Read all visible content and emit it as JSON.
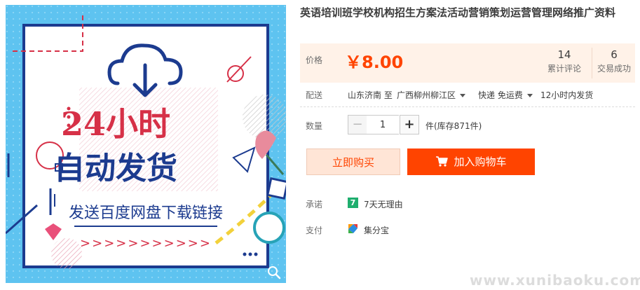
{
  "product": {
    "title": "英语培训班学校机构招生方案法活动营销策划运营管理网络推广资料",
    "image": {
      "headline_1": "24小时",
      "headline_2": "自动发货",
      "subline": "发送百度网盘下载链接",
      "arrows": ">>>>>>>>>>>"
    }
  },
  "price": {
    "label": "价格",
    "value": "￥8.00",
    "reviews_count": "14",
    "reviews_label": "累计评论",
    "sales_count": "6",
    "sales_label": "交易成功"
  },
  "shipping": {
    "label": "配送",
    "from": "山东济南 至",
    "to": "广西柳州柳江区",
    "method": "快递 免运费",
    "eta": "12小时内发货"
  },
  "quantity": {
    "label": "数量",
    "minus": "−",
    "value": "1",
    "plus": "+",
    "stock_note": "件(库存871件)"
  },
  "buttons": {
    "buy_now": "立即购买",
    "add_to_cart": "加入购物车"
  },
  "promise": {
    "label": "承诺",
    "badge": "7",
    "text": "7天无理由"
  },
  "payment": {
    "label": "支付",
    "text": "集分宝"
  },
  "watermark": "www.xunibaoku.com",
  "colors": {
    "accent": "#ff4400",
    "price_bg": "#fff2e8",
    "image_bg": "#5ec3f0",
    "headline_red": "#d63047",
    "headline_blue": "#1c3b8f"
  }
}
